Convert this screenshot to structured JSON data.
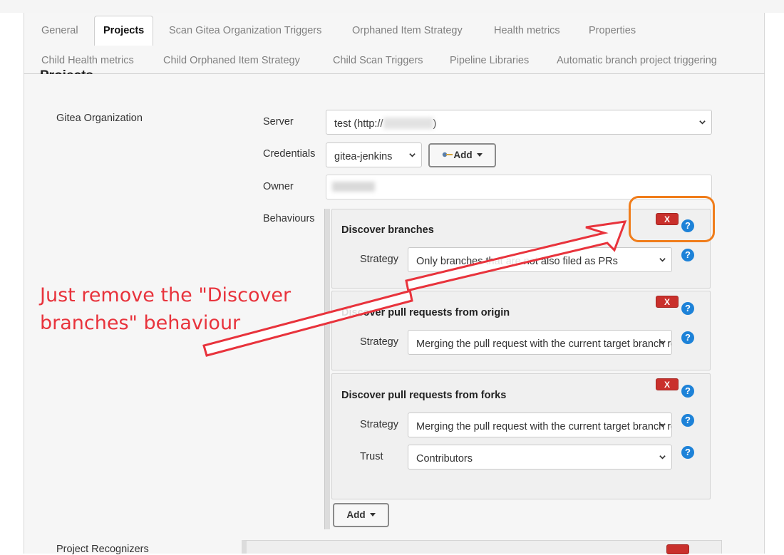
{
  "tabs_row1": [
    "General",
    "Projects",
    "Scan Gitea Organization Triggers",
    "Orphaned Item Strategy",
    "Health metrics",
    "Properties"
  ],
  "tabs_row2": [
    "Child Health metrics",
    "Child Orphaned Item Strategy",
    "Child Scan Triggers",
    "Pipeline Libraries",
    "Automatic branch project triggering"
  ],
  "active_tab": "Projects",
  "section_title": "Projects",
  "source_label": "Gitea Organization",
  "server": {
    "label": "Server",
    "value": "test (http://",
    "value_suffix": ")"
  },
  "credentials": {
    "label": "Credentials",
    "value": "gitea-jenkins",
    "add_label": "Add"
  },
  "owner": {
    "label": "Owner"
  },
  "behaviours_label": "Behaviours",
  "behaviours": [
    {
      "title": "Discover branches",
      "strategy_label": "Strategy",
      "strategy_value": "Only branches that are not also filed as PRs",
      "remove_label": "X"
    },
    {
      "title": "Discover pull requests from origin",
      "strategy_label": "Strategy",
      "strategy_value": "Merging the pull request with the current target branch revision",
      "remove_label": "X"
    },
    {
      "title": "Discover pull requests from forks",
      "strategy_label": "Strategy",
      "strategy_value": "Merging the pull request with the current target branch revision",
      "trust_label": "Trust",
      "trust_value": "Contributors",
      "remove_label": "X"
    }
  ],
  "add_behaviour_label": "Add",
  "project_recognizers_label": "Project Recognizers",
  "help_glyph": "?",
  "annotation": {
    "line1": "Just remove the \"Discover",
    "line2": "branches\" behaviour"
  },
  "colors": {
    "annotation": "#e8333c",
    "highlight_box": "#f07d1b",
    "remove_button": "#c9302c",
    "help_icon": "#1d82d8"
  }
}
